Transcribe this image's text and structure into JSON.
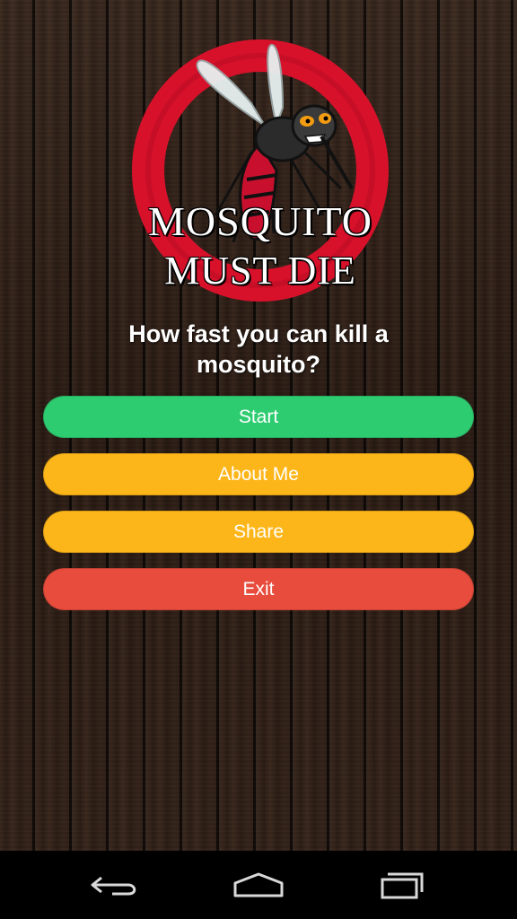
{
  "logo": {
    "line1": "MOSQUITO",
    "line2": "MUST DIE",
    "icon": "mosquito-logo-icon"
  },
  "tagline": "How fast you can kill a mosquito?",
  "buttons": {
    "start": {
      "label": "Start",
      "color": "#2ecc71"
    },
    "about": {
      "label": "About Me",
      "color": "#fdb619"
    },
    "share": {
      "label": "Share",
      "color": "#fdb619"
    },
    "exit": {
      "label": "Exit",
      "color": "#e74c3c"
    }
  },
  "navbar": {
    "back_icon": "back-icon",
    "home_icon": "home-icon",
    "recent_icon": "recent-apps-icon"
  },
  "colors": {
    "logo_ring": "#d8112b",
    "background": "#2c1d15"
  }
}
